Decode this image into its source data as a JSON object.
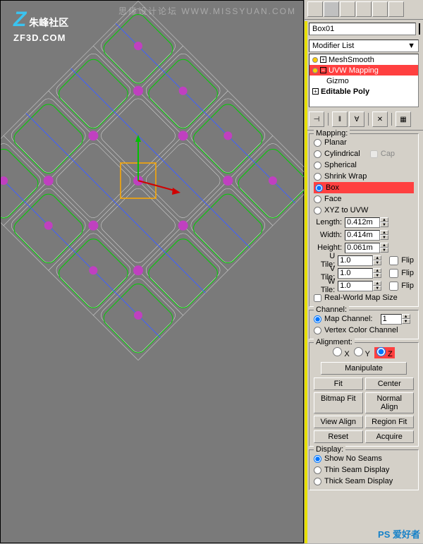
{
  "watermark_top": "思缘设计论坛  WWW.MISSYUAN.COM",
  "logo": {
    "brand": "朱峰社区",
    "url": "ZF3D.COM"
  },
  "object_name": "Box01",
  "modifier_list_label": "Modifier List",
  "modifiers": [
    {
      "name": "MeshSmooth",
      "expanded": false
    },
    {
      "name": "UVW Mapping",
      "expanded": true,
      "selected": true
    },
    {
      "name": "Gizmo",
      "sub": true
    },
    {
      "name": "Editable Poly",
      "expanded": false
    }
  ],
  "mapping": {
    "title": "Mapping:",
    "options": [
      "Planar",
      "Cylindrical",
      "Spherical",
      "Shrink Wrap",
      "Box",
      "Face",
      "XYZ to UVW"
    ],
    "selected": "Box",
    "cap_label": "Cap",
    "length_label": "Length:",
    "length": "0.412m",
    "width_label": "Width:",
    "width": "0.414m",
    "height_label": "Height:",
    "height": "0.061m",
    "utile_label": "U Tile:",
    "utile": "1.0",
    "vtile_label": "V Tile:",
    "vtile": "1.0",
    "wtile_label": "W Tile:",
    "wtile": "1.0",
    "flip_label": "Flip",
    "realworld_label": "Real-World Map Size"
  },
  "channel": {
    "title": "Channel:",
    "map_channel_label": "Map Channel:",
    "map_channel": "1",
    "vertex_color_label": "Vertex Color Channel"
  },
  "alignment": {
    "title": "Alignment:",
    "x": "X",
    "y": "Y",
    "z": "Z",
    "manipulate": "Manipulate",
    "fit": "Fit",
    "center": "Center",
    "bitmap_fit": "Bitmap Fit",
    "normal_align": "Normal Align",
    "view_align": "View Align",
    "region_fit": "Region Fit",
    "reset": "Reset",
    "acquire": "Acquire"
  },
  "display": {
    "title": "Display:",
    "show_no_seams": "Show No Seams",
    "thin_seam": "Thin Seam Display",
    "thick_seam": "Thick Seam Display"
  },
  "bottom_watermark": "PS 爱好者"
}
